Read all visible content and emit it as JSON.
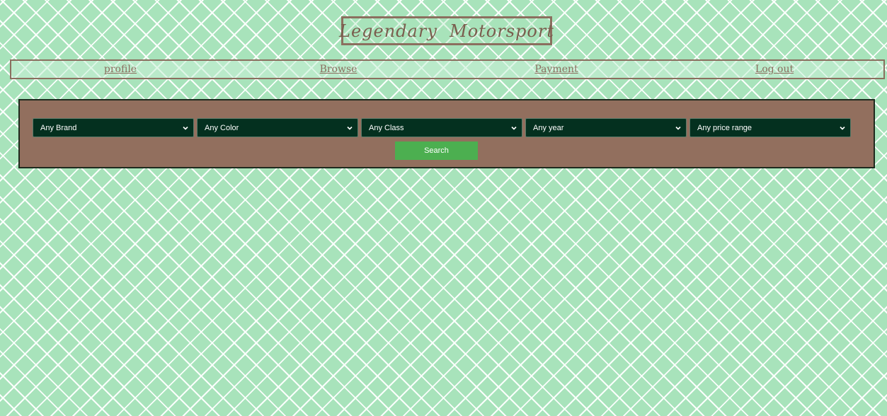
{
  "header": {
    "logo_text": "Legendary  Motorsport"
  },
  "nav": {
    "items": [
      {
        "label": "profile"
      },
      {
        "label": "Browse"
      },
      {
        "label": "Payment"
      },
      {
        "label": "Log out"
      }
    ]
  },
  "filters": {
    "brand": "Any Brand",
    "color": "Any Color",
    "class": "Any Class",
    "year": "Any year",
    "price": "Any price range"
  },
  "search": {
    "button_label": "Search"
  },
  "colors": {
    "background": "#a8e3bb",
    "brand_brown": "#8b6f5f",
    "panel": "#926f5e",
    "select_bg": "#04301f",
    "button": "#4caf50"
  },
  "icons": {
    "dropdown": "chevron-down-icon"
  }
}
